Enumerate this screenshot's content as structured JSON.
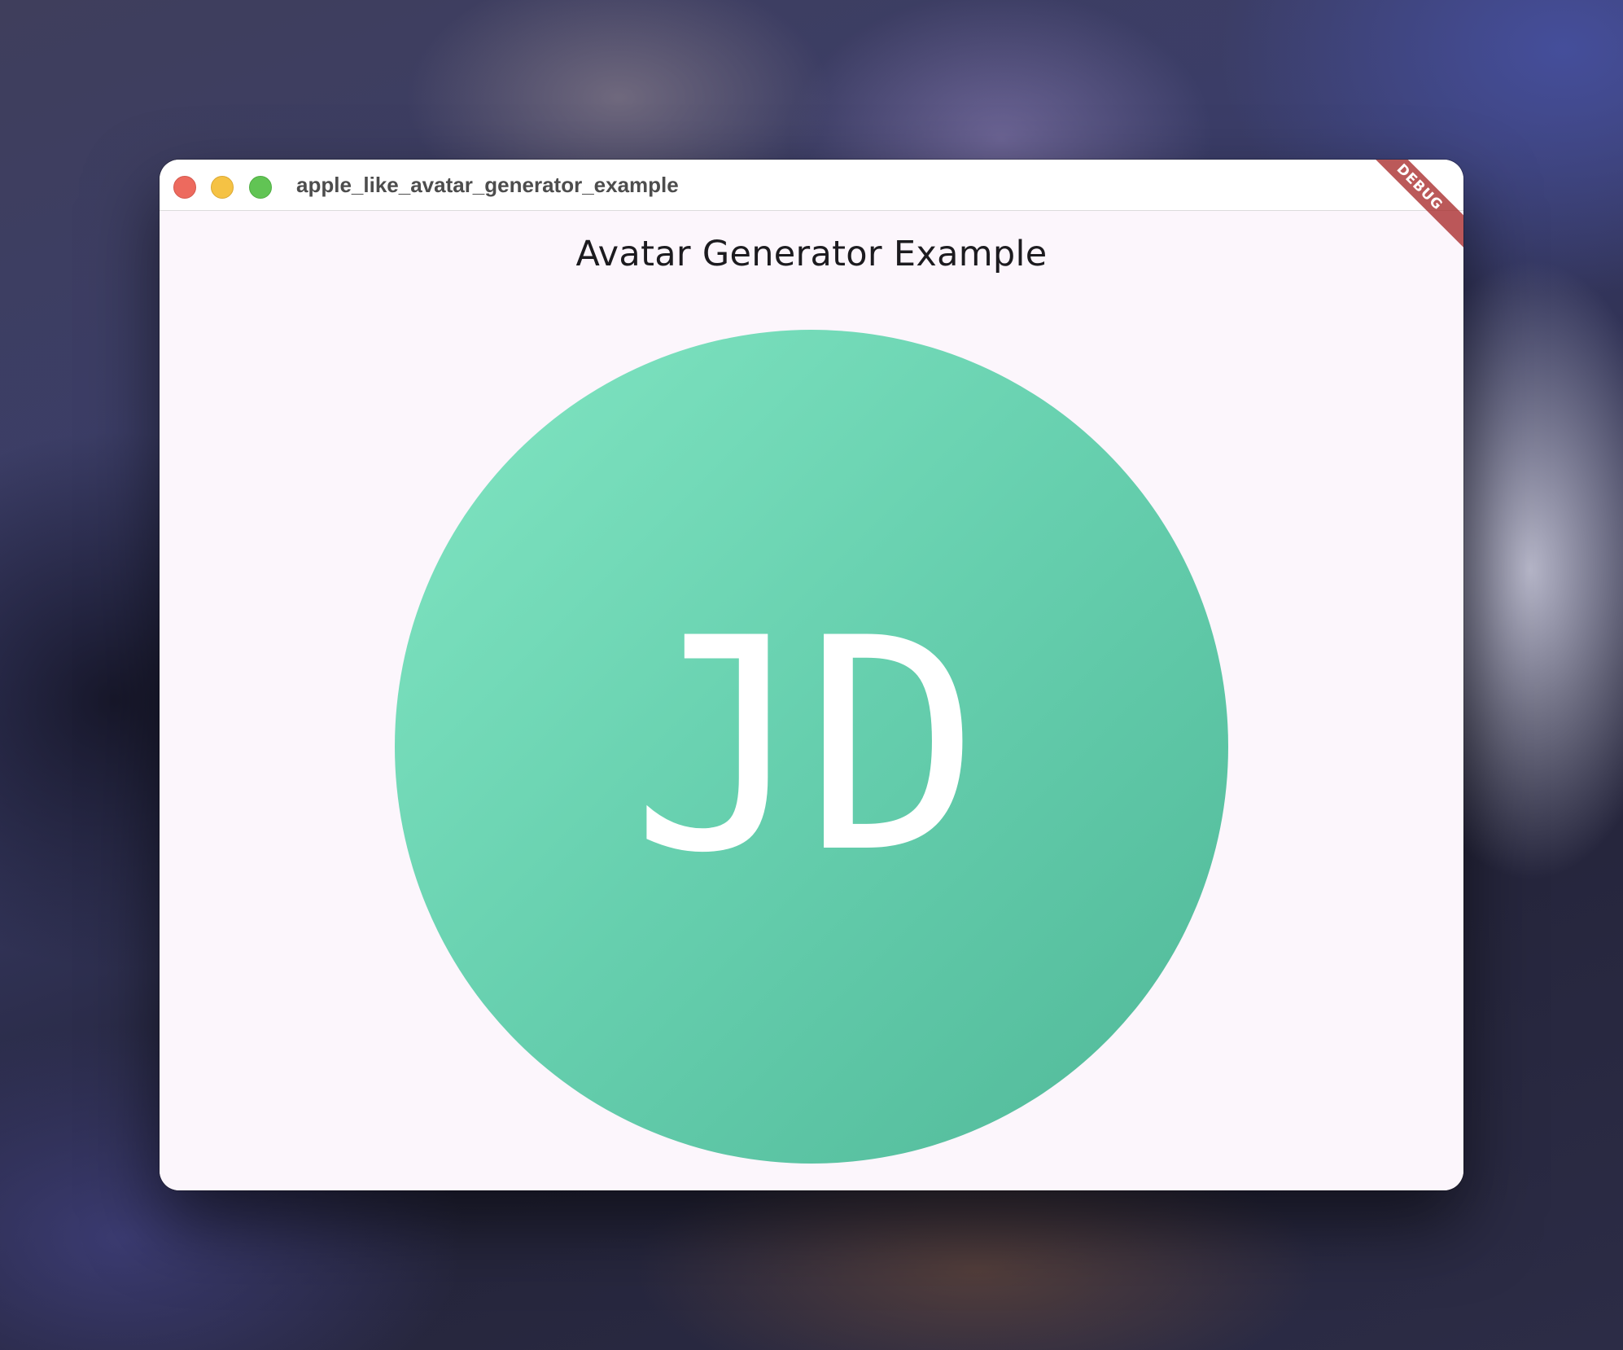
{
  "window": {
    "title": "apple_like_avatar_generator_example"
  },
  "app_bar": {
    "title": "Avatar Generator Example"
  },
  "avatar": {
    "initials": "JD",
    "gradient_start": "#82e6c3",
    "gradient_end": "#50b898",
    "text_color": "#ffffff"
  },
  "debug_banner": {
    "label": "DEBUG",
    "color": "#a82a2a"
  },
  "traffic_lights": {
    "close_color": "#ed6a5e",
    "minimize_color": "#f5c244",
    "zoom_color": "#61c454"
  }
}
